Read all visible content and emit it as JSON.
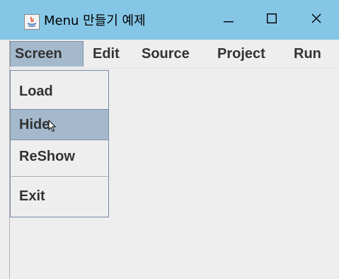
{
  "window": {
    "title": "Menu 만들기 예제",
    "app_icon": "java-icon",
    "controls": {
      "minimize_icon": "minimize-icon",
      "maximize_icon": "maximize-icon",
      "close_icon": "close-icon",
      "minimize_glyph": "—",
      "maximize_glyph": "☐",
      "close_glyph": "✕"
    }
  },
  "menubar": {
    "items": [
      {
        "label": "Screen",
        "active": true
      },
      {
        "label": "Edit"
      },
      {
        "label": "Source"
      },
      {
        "label": "Project"
      },
      {
        "label": "Run"
      }
    ]
  },
  "dropdown": {
    "items": [
      {
        "label": "Load"
      },
      {
        "label": "Hide",
        "hovered": true
      },
      {
        "label": "ReShow"
      },
      {
        "label": "Exit"
      }
    ]
  },
  "colors": {
    "titlebar": "#85c6e6",
    "menu_highlight": "#a4b9cc",
    "background": "#eeeeee"
  }
}
